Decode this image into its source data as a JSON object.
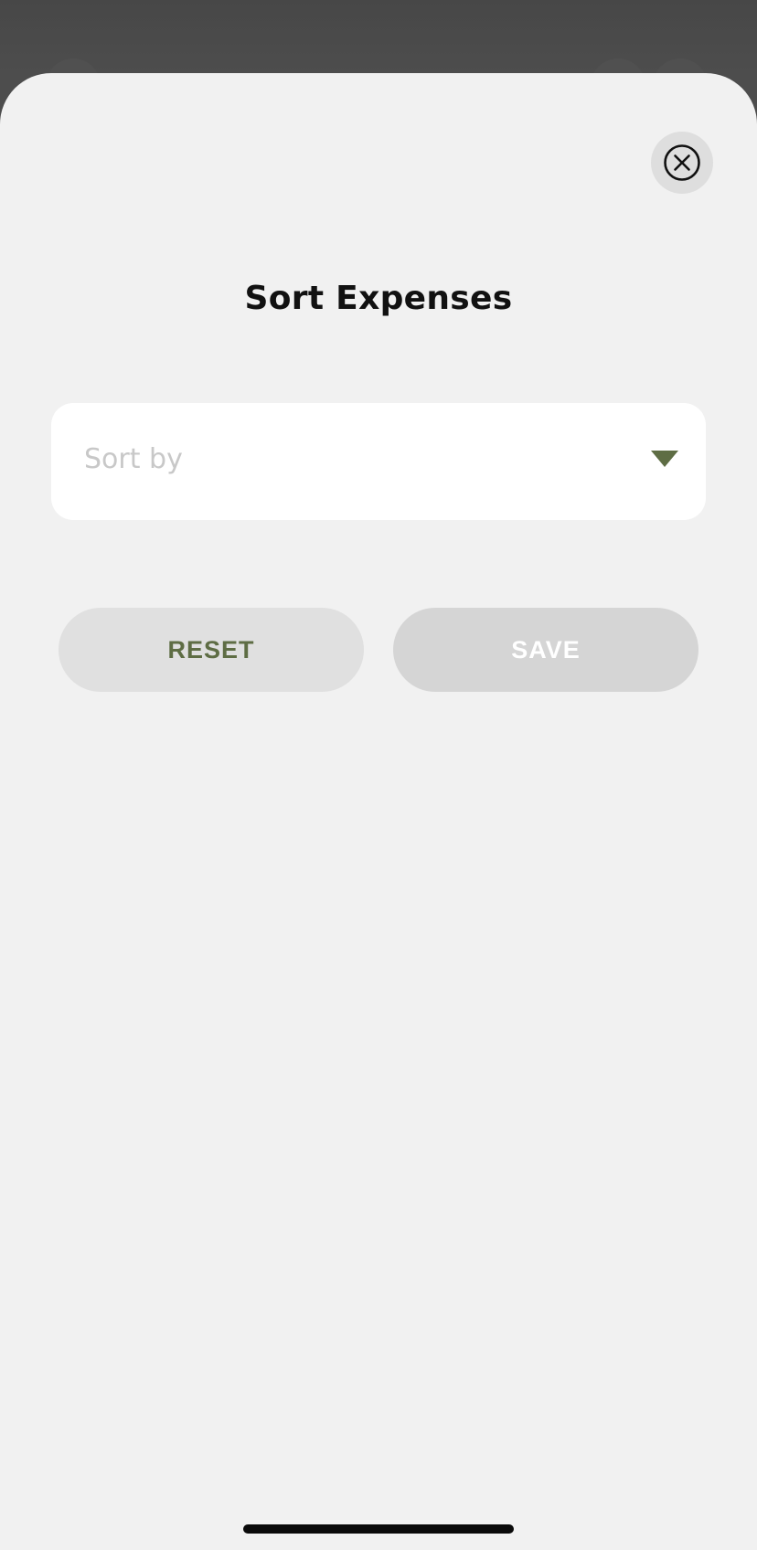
{
  "modal": {
    "title": "Sort Expenses",
    "close_icon": "close-circle-icon"
  },
  "sort_select": {
    "placeholder": "Sort by",
    "value": "",
    "caret_icon": "caret-down-icon",
    "caret_color": "#5e6d44"
  },
  "actions": {
    "reset_label": "RESET",
    "save_label": "SAVE"
  },
  "colors": {
    "accent": "#5e6d44",
    "sheet_background": "#f1f1f1",
    "backdrop": "#4a4a4a"
  }
}
